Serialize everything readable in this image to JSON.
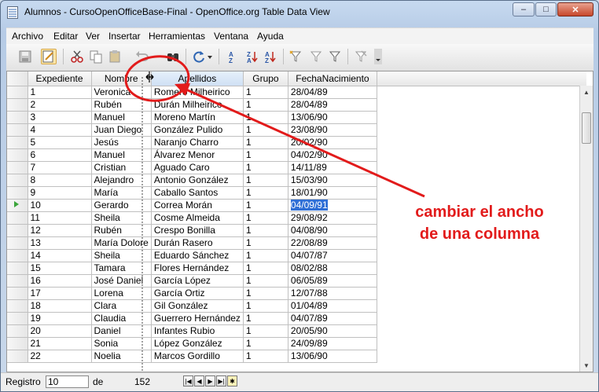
{
  "window": {
    "title": "Alumnos - CursoOpenOfficeBase-Final - OpenOffice.org Table Data View",
    "min_label": "–",
    "max_label": "□",
    "close_label": "✕"
  },
  "menu": {
    "items": [
      "Archivo",
      "Editar",
      "Ver",
      "Insertar",
      "Herramientas",
      "Ventana",
      "Ayuda"
    ]
  },
  "toolbar": {
    "icons": [
      "save-icon",
      "edit-mode-icon",
      "cut-icon",
      "copy-icon",
      "paste-icon",
      "undo-icon",
      "find-icon",
      "refresh-icon",
      "sort-ascending-icon",
      "sort-descending-icon",
      "sort-icon",
      "autofilter-icon",
      "standard-filter-icon",
      "filter-icon",
      "remove-filter-icon"
    ]
  },
  "table": {
    "columns": [
      "Expediente",
      "Nombre",
      "Apellidos",
      "Grupo",
      "FechaNacimiento"
    ],
    "rows": [
      [
        "1",
        "Veronica",
        "Romero Milheirico",
        "1",
        "28/04/89"
      ],
      [
        "2",
        "Rubén",
        "Durán Milheirico",
        "1",
        "28/04/89"
      ],
      [
        "3",
        "Manuel",
        "Moreno Martín",
        "1",
        "13/06/90"
      ],
      [
        "4",
        "Juan Diego",
        "González Pulido",
        "1",
        "23/08/90"
      ],
      [
        "5",
        "Jesús",
        "Naranjo Charro",
        "1",
        "20/02/90"
      ],
      [
        "6",
        "Manuel",
        "Álvarez Menor",
        "1",
        "04/02/90"
      ],
      [
        "7",
        "Cristian",
        "Aguado Caro",
        "1",
        "14/11/89"
      ],
      [
        "8",
        "Alejandro",
        "Antonio González",
        "1",
        "15/03/90"
      ],
      [
        "9",
        "María",
        "Caballo Santos",
        "1",
        "18/01/90"
      ],
      [
        "10",
        "Gerardo",
        "Correa Morán",
        "1",
        "04/09/91"
      ],
      [
        "11",
        "Sheila",
        "Cosme Almeida",
        "1",
        "29/08/92"
      ],
      [
        "12",
        "Rubén",
        "Crespo Bonilla",
        "1",
        "04/08/90"
      ],
      [
        "13",
        "María Dolore",
        "Durán Rasero",
        "1",
        "22/08/89"
      ],
      [
        "14",
        "Sheila",
        "Eduardo Sánchez",
        "1",
        "04/07/87"
      ],
      [
        "15",
        "Tamara",
        "Flores Hernández",
        "1",
        "08/02/88"
      ],
      [
        "16",
        "José Daniel",
        "García López",
        "1",
        "06/05/89"
      ],
      [
        "17",
        "Lorena",
        "García Ortiz",
        "1",
        "12/07/88"
      ],
      [
        "18",
        "Clara",
        "Gil González",
        "1",
        "01/04/89"
      ],
      [
        "19",
        "Claudia",
        "Guerrero Hernández",
        "1",
        "04/07/89"
      ],
      [
        "20",
        "Daniel",
        "Infantes Rubio",
        "1",
        "20/05/90"
      ],
      [
        "21",
        "Sonia",
        "López González",
        "1",
        "24/09/89"
      ],
      [
        "22",
        "Noelia",
        "Marcos Gordillo",
        "1",
        "13/06/90"
      ]
    ],
    "current_row_index": 9
  },
  "status": {
    "registro_label": "Registro",
    "registro_value": "10",
    "de_label": "de",
    "total": "152"
  },
  "annotation": {
    "line1": "cambiar el ancho",
    "line2": "de una columna",
    "color": "#e21b1b"
  }
}
